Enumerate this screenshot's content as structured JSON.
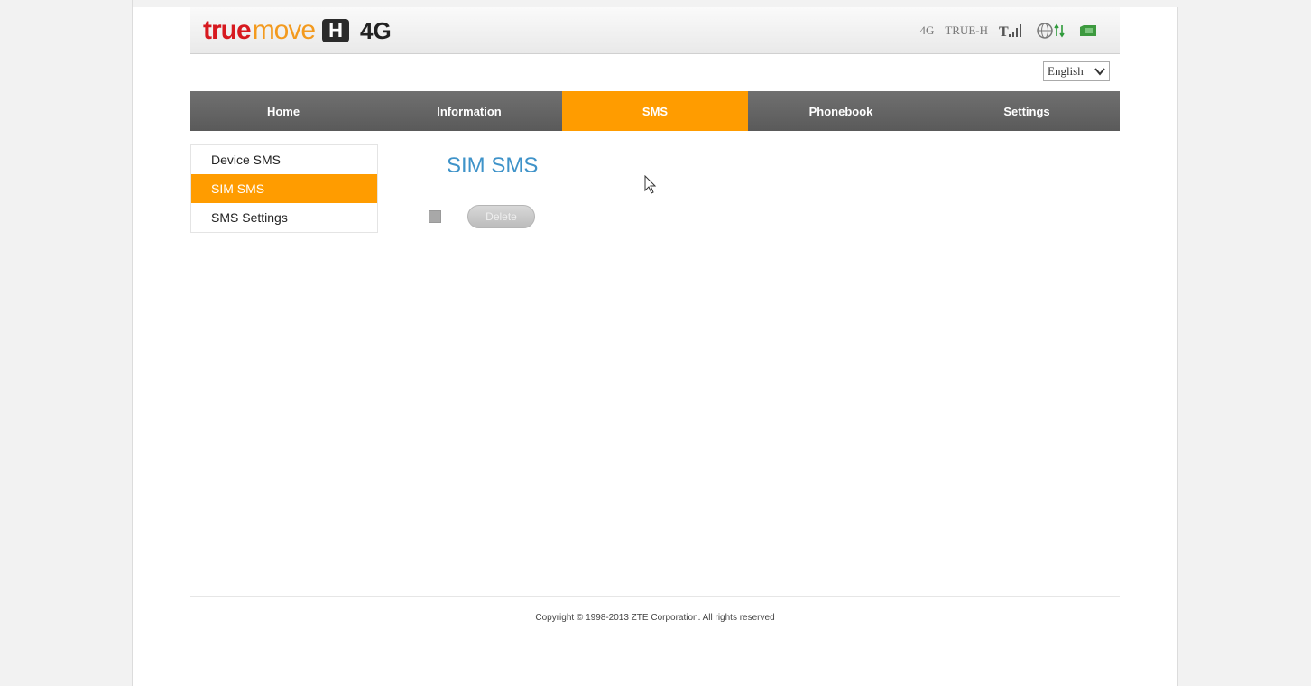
{
  "brand": {
    "word1": "true",
    "word2": "move",
    "badge": "H",
    "suffix": "4G",
    "colors": {
      "red": "#d7191f",
      "orange": "#f39a1e"
    }
  },
  "status_bar": {
    "network_type": "4G",
    "operator": "TRUE-H",
    "icons": [
      "signal-strength-icon",
      "globe-data-icon",
      "sim-card-icon"
    ]
  },
  "language": {
    "selected": "English"
  },
  "nav": {
    "items": [
      {
        "label": "Home",
        "active": false
      },
      {
        "label": "Information",
        "active": false
      },
      {
        "label": "SMS",
        "active": true
      },
      {
        "label": "Phonebook",
        "active": false
      },
      {
        "label": "Settings",
        "active": false
      }
    ],
    "active_color": "#ff9c00"
  },
  "sidebar": {
    "items": [
      {
        "label": "Device SMS",
        "active": false
      },
      {
        "label": "SIM SMS",
        "active": true
      },
      {
        "label": "SMS Settings",
        "active": false
      }
    ]
  },
  "content": {
    "title": "SIM SMS",
    "delete_label": "Delete"
  },
  "footer": {
    "copyright": "Copyright © 1998-2013 ZTE Corporation. All rights reserved"
  }
}
